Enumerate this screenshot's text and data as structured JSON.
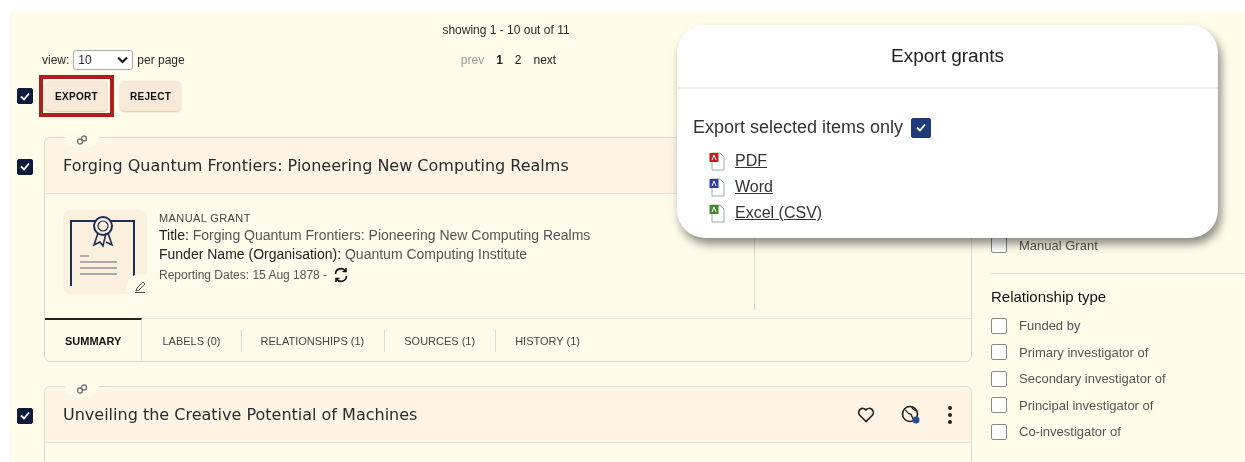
{
  "summary": "showing 1 - 10 out of 11",
  "page_size": {
    "label": "view:",
    "value": "10",
    "suffix": "per page"
  },
  "pagination": {
    "prev": "prev",
    "prev_disabled": true,
    "pages": [
      {
        "label": "1",
        "selected": true
      },
      {
        "label": "2",
        "selected": false
      }
    ],
    "next": "next"
  },
  "select_all": {
    "checked": true
  },
  "bulk_actions": [
    {
      "label": "EXPORT",
      "highlighted": true
    },
    {
      "label": "REJECT",
      "highlighted": false
    }
  ],
  "grants": [
    {
      "checked": true,
      "title": "Forging Quantum Frontiers: Pioneering New Computing Realms",
      "details": {
        "type": "MANUAL GRANT",
        "fields": [
          {
            "label": "Title:",
            "value": "Forging Quantum Frontiers: Pioneering New Computing Realms"
          },
          {
            "label": "Funder Name (Organisation):",
            "value": "Quantum Computing Institute"
          }
        ],
        "reporting": "Reporting Dates: 15 Aug 1878 -"
      },
      "tabs": [
        {
          "label": "SUMMARY",
          "selected": true
        },
        {
          "label": "LABELS (0)",
          "selected": false
        },
        {
          "label": "RELATIONSHIPS (1)",
          "selected": false
        },
        {
          "label": "SOURCES (1)",
          "selected": false
        },
        {
          "label": "HISTORY (1)",
          "selected": false
        }
      ]
    },
    {
      "checked": true,
      "title": "Unveiling the Creative Potential of Machines",
      "show_actions": true
    }
  ],
  "filters": {
    "items": [
      {
        "label": "Manual Grant",
        "checked": false
      }
    ],
    "sections": [
      {
        "title": "Relationship type",
        "options": [
          {
            "label": "Funded by",
            "checked": false
          },
          {
            "label": "Primary investigator of",
            "checked": false
          },
          {
            "label": "Secondary investigator of",
            "checked": false
          },
          {
            "label": "Principal investigator of",
            "checked": false
          },
          {
            "label": "Co-investigator of",
            "checked": false
          }
        ]
      }
    ]
  },
  "export_dialog": {
    "title": "Export grants",
    "selected_only": {
      "label": "Export selected items only",
      "checked": true
    },
    "formats": [
      {
        "label": "PDF",
        "kind": "pdf"
      },
      {
        "label": "Word",
        "kind": "word"
      },
      {
        "label": "Excel (CSV)",
        "kind": "excel"
      }
    ]
  }
}
